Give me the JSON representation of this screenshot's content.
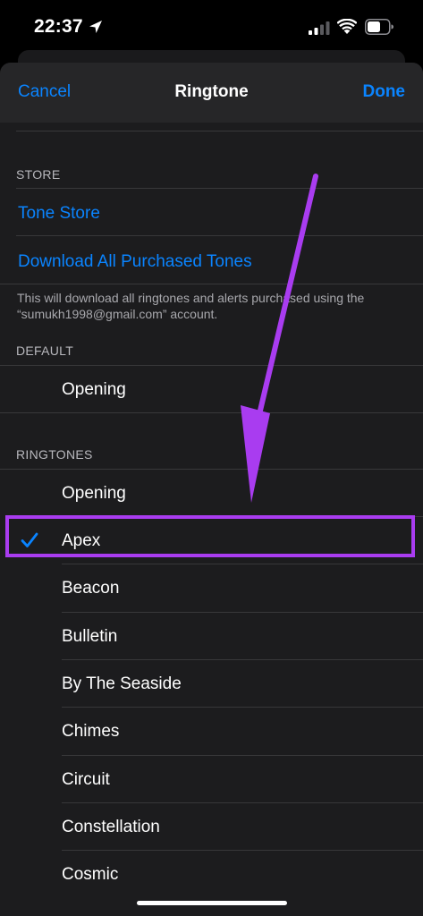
{
  "status_bar": {
    "time": "22:37"
  },
  "nav": {
    "cancel_label": "Cancel",
    "title": "Ringtone",
    "done_label": "Done"
  },
  "store": {
    "header": "STORE",
    "tone_store": "Tone Store",
    "download_all": "Download All Purchased Tones",
    "footnote": "This will download all ringtones and alerts purchased using the “sumukh1998@gmail.com” account."
  },
  "default": {
    "header": "DEFAULT",
    "items": [
      {
        "label": "Opening"
      }
    ]
  },
  "ringtones": {
    "header": "RINGTONES",
    "items": [
      {
        "label": "Opening"
      },
      {
        "label": "Apex"
      },
      {
        "label": "Beacon"
      },
      {
        "label": "Bulletin"
      },
      {
        "label": "By The Seaside"
      },
      {
        "label": "Chimes"
      },
      {
        "label": "Circuit"
      },
      {
        "label": "Constellation"
      },
      {
        "label": "Cosmic"
      }
    ]
  },
  "colors": {
    "accent": "#0a84ff",
    "annotation": "#a93cf0",
    "sheet_background": "#1c1c1e",
    "nav_background": "#262628"
  },
  "icons": {
    "location": "location-arrow-icon",
    "signal": "cellular-signal-icon",
    "wifi": "wifi-icon",
    "battery": "battery-icon",
    "selected": "checkmark-icon"
  }
}
